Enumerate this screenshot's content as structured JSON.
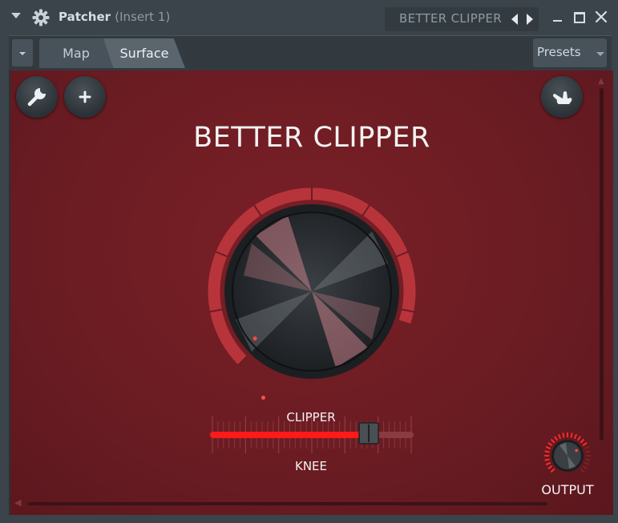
{
  "window": {
    "title": "Patcher",
    "subtitle": "(Insert 1)",
    "plugin_name": "BETTER CLIPPER",
    "icons": [
      "menu-arrow-icon",
      "gear-icon",
      "prev-arrow-icon",
      "next-arrow-icon",
      "minimize-icon",
      "maximize-icon",
      "close-icon"
    ]
  },
  "tabs": [
    {
      "label": "Map",
      "active": false
    },
    {
      "label": "Surface",
      "active": true
    }
  ],
  "presets_label": "Presets",
  "surface": {
    "title": "BETTER CLIPPER",
    "background_color": "#6b1c23",
    "buttons": [
      "wrench-icon",
      "plus-icon",
      "hand-icon"
    ],
    "main_knob_label": "CLIPPER",
    "main_knob_value": 0.58,
    "slider_label": "KNEE",
    "slider_value": 0.78,
    "output_label": "OUTPUT",
    "output_value": 0.72,
    "accent_color": "#ff2a2a"
  }
}
